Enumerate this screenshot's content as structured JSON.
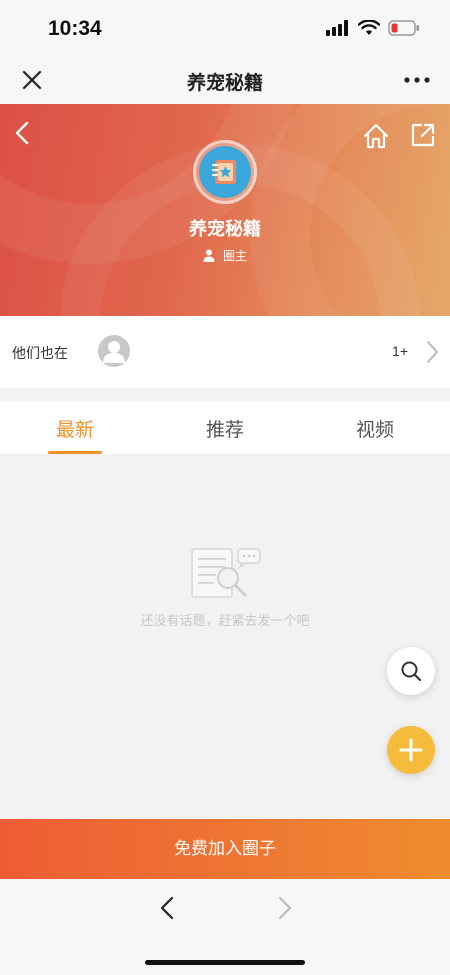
{
  "status_bar": {
    "time": "10:34"
  },
  "nav": {
    "title": "养宠秘籍"
  },
  "hero": {
    "title": "养宠秘籍",
    "role": "圈主"
  },
  "members": {
    "label": "他们也在",
    "count": "1+"
  },
  "tabs": [
    {
      "label": "最新",
      "active": true
    },
    {
      "label": "推荐",
      "active": false
    },
    {
      "label": "视频",
      "active": false
    }
  ],
  "empty_state": {
    "text": "还没有话题，赶紧去发一个吧"
  },
  "join_button": {
    "label": "免费加入圈子"
  },
  "colors": {
    "accent": "#f0932b",
    "hero_start": "#dc5046",
    "hero_end": "#e5a86a",
    "fab_add": "#f5bc3c",
    "join_start": "#ee5c35",
    "join_end": "#f08c30"
  },
  "icons": {
    "nav_close": "close-icon",
    "nav_more": "more-icon",
    "hero_back": "back-icon",
    "hero_home": "home-icon",
    "hero_share": "share-icon",
    "role": "person-icon",
    "members_chevron": "chevron-right-icon",
    "fab_search": "search-icon",
    "fab_add": "plus-icon",
    "browser_back": "chevron-left-icon",
    "browser_forward": "chevron-right-icon"
  }
}
